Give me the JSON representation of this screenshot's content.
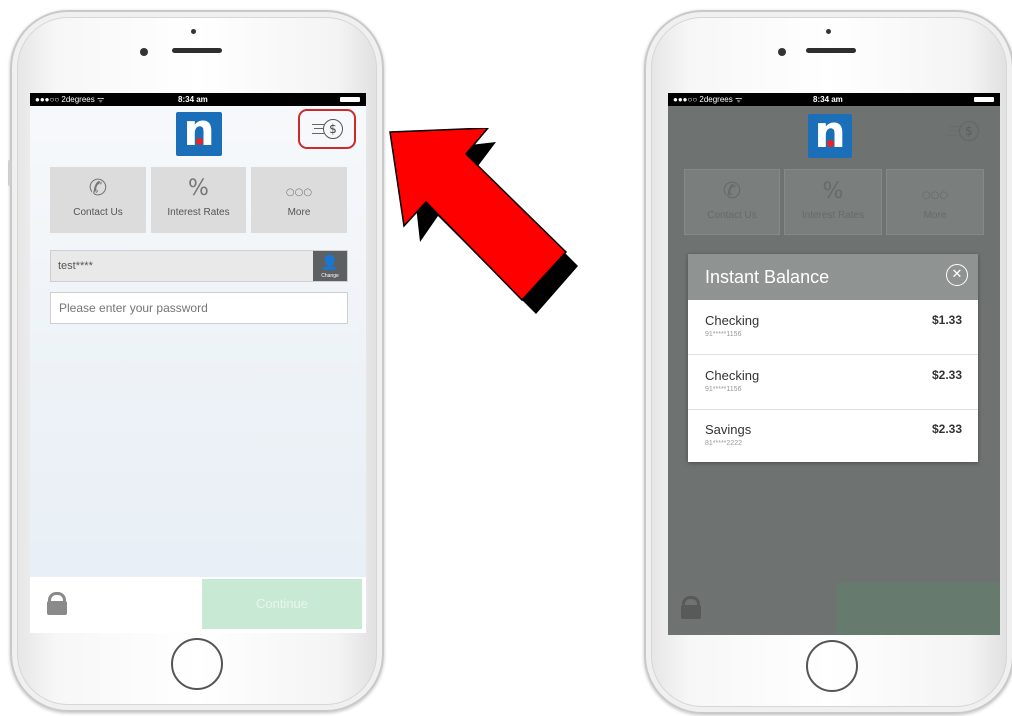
{
  "left_screen": {
    "status": {
      "carrier": "●●●○○ 2degrees ᯤ",
      "time": "8:34 am"
    },
    "logo_letter": "n",
    "quick_links": [
      {
        "label": "Contact Us",
        "icon": "phone-icon",
        "glyph": "✆"
      },
      {
        "label": "Interest Rates",
        "icon": "percent-icon",
        "glyph": "%"
      },
      {
        "label": "More",
        "icon": "more-dots-icon",
        "glyph": "○○○"
      }
    ],
    "username": {
      "value": "test****",
      "change_label": "Change"
    },
    "password": {
      "placeholder": "Please enter your password"
    },
    "continue_label": "Continue"
  },
  "right_screen": {
    "status": {
      "carrier": "●●●○○ 2degrees ᯤ",
      "time": "8:34 am"
    },
    "logo_letter": "n",
    "quick_links": [
      {
        "label": "Contact Us",
        "glyph": "✆"
      },
      {
        "label": "Interest Rates",
        "glyph": "%"
      },
      {
        "label": "More",
        "glyph": "○○○"
      }
    ],
    "modal": {
      "title": "Instant Balance",
      "close_glyph": "✕",
      "accounts": [
        {
          "name": "Checking",
          "number": "91*****1156",
          "balance": "$1.33"
        },
        {
          "name": "Checking",
          "number": "91*****1156",
          "balance": "$2.33"
        },
        {
          "name": "Savings",
          "number": "81*****2222",
          "balance": "$2.33"
        }
      ]
    }
  },
  "colors": {
    "brand_blue": "#1a6fb8",
    "highlight_red": "#cf2a2a",
    "arrow_red": "#ff0000",
    "continue_green": "#c8e9d4"
  }
}
